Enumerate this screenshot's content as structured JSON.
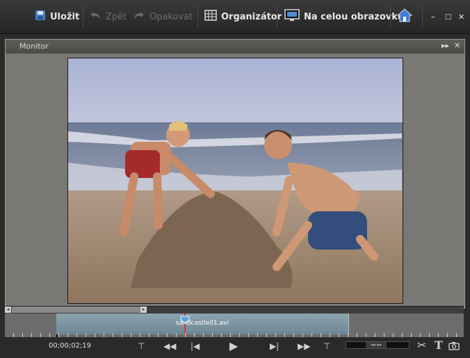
{
  "toolbar": {
    "save_label": "Uložit",
    "undo_label": "Zpět",
    "redo_label": "Opakovat",
    "organizer_label": "Organizátor",
    "fullscreen_label": "Na celou obrazovku"
  },
  "monitor": {
    "title": "Monitor"
  },
  "timeline": {
    "clip_name": "sandcastle01.avi",
    "timecode": "00;00;02;19"
  }
}
